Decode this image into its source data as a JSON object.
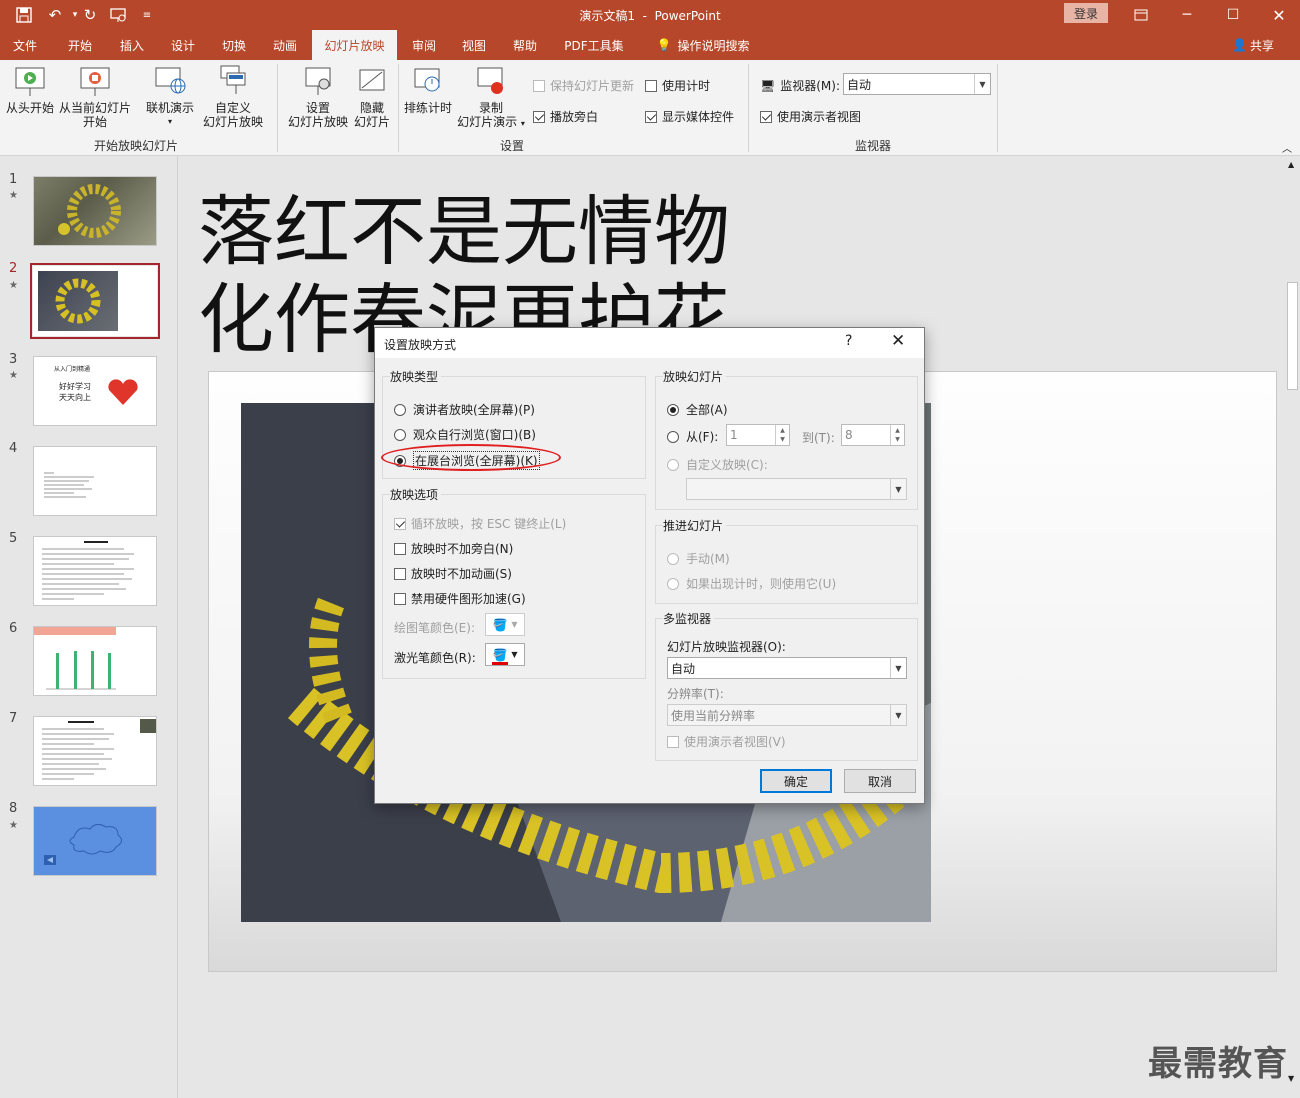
{
  "titlebar": {
    "document_title": "演示文稿1",
    "app_name": "PowerPoint",
    "title_sep": "  -  ",
    "login": "登录"
  },
  "menu": {
    "tabs": [
      "文件",
      "开始",
      "插入",
      "设计",
      "切换",
      "动画",
      "幻灯片放映",
      "审阅",
      "视图",
      "帮助",
      "PDF工具集"
    ],
    "active_tab": "幻灯片放映",
    "tell_me": "操作说明搜索",
    "share": "共享"
  },
  "ribbon": {
    "start": {
      "from_beginning": "从头开始",
      "from_current": [
        "从当前幻灯片",
        "开始"
      ],
      "online": [
        "联机演示"
      ],
      "custom": [
        "自定义",
        "幻灯片放映"
      ],
      "group": "开始放映幻灯片"
    },
    "setup": {
      "set_up_show": [
        "设置",
        "幻灯片放映"
      ],
      "hide_slide": [
        "隐藏",
        "幻灯片"
      ],
      "rehearse": "排练计时",
      "record": [
        "录制",
        "幻灯片演示"
      ],
      "keep_updated": "保持幻灯片更新",
      "use_timings": "使用计时",
      "play_narrations": "播放旁白",
      "show_media_controls": "显示媒体控件",
      "group": "设置"
    },
    "monitors": {
      "monitor_label": "监视器(M):",
      "monitor_value": "自动",
      "presenter_view": "使用演示者视图",
      "group": "监视器"
    }
  },
  "thumbnails": [
    {
      "num": "1",
      "star": true
    },
    {
      "num": "2",
      "star": true
    },
    {
      "num": "3",
      "star": true,
      "line1": "从入门到精通",
      "line2": "好好学习",
      "line3": "天天向上"
    },
    {
      "num": "4",
      "star": false
    },
    {
      "num": "5",
      "star": false
    },
    {
      "num": "6",
      "star": false
    },
    {
      "num": "7",
      "star": false
    },
    {
      "num": "8",
      "star": true
    }
  ],
  "selected_slide": 2,
  "slide": {
    "title_line1": "落红不是无情物",
    "title_line2": "化作春泥更护花"
  },
  "dialog": {
    "title": "设置放映方式",
    "help": "?",
    "close": "✕",
    "show_type": {
      "label": "放映类型",
      "options": [
        "演讲者放映(全屏幕)(P)",
        "观众自行浏览(窗口)(B)",
        "在展台浏览(全屏幕)(K)"
      ],
      "selected": 2
    },
    "show_options": {
      "label": "放映选项",
      "loop": "循环放映，按 ESC 键终止(L)",
      "no_narration": "放映时不加旁白(N)",
      "no_animation": "放映时不加动画(S)",
      "disable_hw": "禁用硬件图形加速(G)",
      "pen_color": "绘图笔颜色(E):",
      "laser_color": "激光笔颜色(R):"
    },
    "show_slides": {
      "label": "放映幻灯片",
      "all": "全部(A)",
      "from": "从(F):",
      "from_value": "1",
      "to": "到(T):",
      "to_value": "8",
      "custom": "自定义放映(C):"
    },
    "advance": {
      "label": "推进幻灯片",
      "manual": "手动(M)",
      "timings": "如果出现计时，则使用它(U)"
    },
    "multi_monitor": {
      "label": "多监视器",
      "monitor_label": "幻灯片放映监视器(O):",
      "monitor_value": "自动",
      "resolution_label": "分辨率(T):",
      "resolution_value": "使用当前分辨率",
      "presenter_view": "使用演示者视图(V)"
    },
    "ok": "确定",
    "cancel": "取消"
  },
  "colors": {
    "accent": "#b7472a",
    "highlight": "#e02020",
    "laser": "#e00000"
  },
  "watermark": "最需教育"
}
